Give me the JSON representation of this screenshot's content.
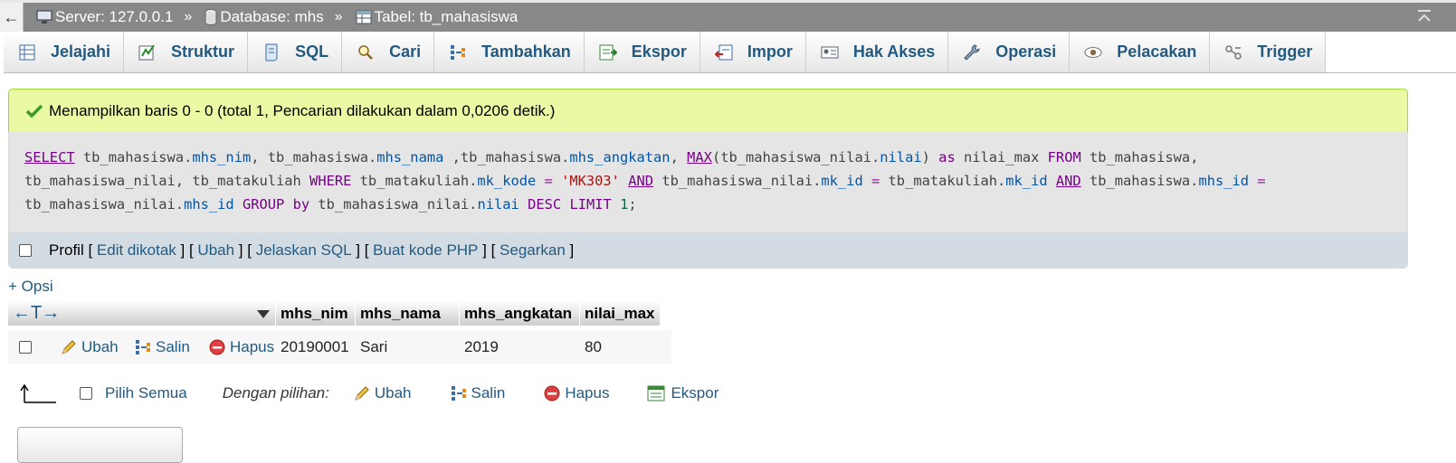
{
  "breadcrumb": {
    "back": "←",
    "server": "Server: 127.0.0.1",
    "sep": "»",
    "database": "Database: mhs",
    "table": "Tabel: tb_mahasiswa"
  },
  "tabs": [
    {
      "label": "Jelajahi",
      "icon": "browse-icon"
    },
    {
      "label": "Struktur",
      "icon": "structure-icon"
    },
    {
      "label": "SQL",
      "icon": "sql-icon"
    },
    {
      "label": "Cari",
      "icon": "search-icon"
    },
    {
      "label": "Tambahkan",
      "icon": "insert-icon"
    },
    {
      "label": "Ekspor",
      "icon": "export-icon"
    },
    {
      "label": "Impor",
      "icon": "import-icon"
    },
    {
      "label": "Hak Akses",
      "icon": "privileges-icon"
    },
    {
      "label": "Operasi",
      "icon": "wrench-icon"
    },
    {
      "label": "Pelacakan",
      "icon": "eye-icon"
    },
    {
      "label": "Trigger",
      "icon": "trigger-icon"
    }
  ],
  "message": "Menampilkan baris 0 - 0 (total 1, Pencarian dilakukan dalam 0,0206 detik.)",
  "sql": {
    "select": "SELECT",
    "t1": "tb_mahasiswa.",
    "f1": "mhs_nim",
    "c1": ", tb_mahasiswa.",
    "f2": "mhs_nama",
    "c2": " ,tb_mahasiswa.",
    "f3": "mhs_angkatan",
    "c3": ", ",
    "max": "MAX",
    "c4": "(tb_mahasiswa_nilai.",
    "f4": "nilai",
    "c5": ")",
    "as": "as",
    "c6": " nilai_max ",
    "from": "FROM",
    "c7": " tb_mahasiswa,",
    "l2a": "tb_mahasiswa_nilai, tb_matakuliah ",
    "where": "WHERE",
    "c8": " tb_matakuliah.",
    "f5": "mk_kode",
    "eq1": " = ",
    "s1": "'MK303'",
    "and1": "AND",
    "c9": " tb_mahasiswa_nilai.",
    "f6": "mk_id",
    "eq2": " = ",
    "c10": "tb_matakuliah.",
    "f7": "mk_id",
    "and2": "AND",
    "c11": " tb_mahasiswa.",
    "f8": "mhs_id",
    "eq3": " =",
    "l3a": "tb_mahasiswa_nilai.",
    "f9": "mhs_id",
    "group": "GROUP",
    "by": "by",
    "c12": " tb_mahasiswa_nilai.",
    "f10": "nilai",
    "desc": "DESC",
    "limit": "LIMIT",
    "n1": "1",
    "end": ";"
  },
  "profile": {
    "label": "Profil",
    "links": [
      "Edit dikotak",
      "Ubah",
      "Jelaskan SQL",
      "Buat kode PHP",
      "Segarkan"
    ]
  },
  "options_link": "+ Opsi",
  "table": {
    "ctrl_arrows": "←T→",
    "sort_icon": "triangle-down-icon",
    "columns": [
      "mhs_nim",
      "mhs_nama",
      "mhs_angkatan",
      "nilai_max"
    ],
    "row_actions": {
      "edit": "Ubah",
      "copy": "Salin",
      "delete": "Hapus"
    },
    "rows": [
      {
        "mhs_nim": "20190001",
        "mhs_nama": "Sari",
        "mhs_angkatan": "2019",
        "nilai_max": "80"
      }
    ]
  },
  "bulk": {
    "select_all": "Pilih Semua",
    "with_selected": "Dengan pilihan:",
    "edit": "Ubah",
    "copy": "Salin",
    "delete": "Hapus",
    "export": "Ekspor"
  },
  "colors": {
    "link": "#235a81",
    "success_bg": "#ebf8a4",
    "topbar": "#888888"
  }
}
